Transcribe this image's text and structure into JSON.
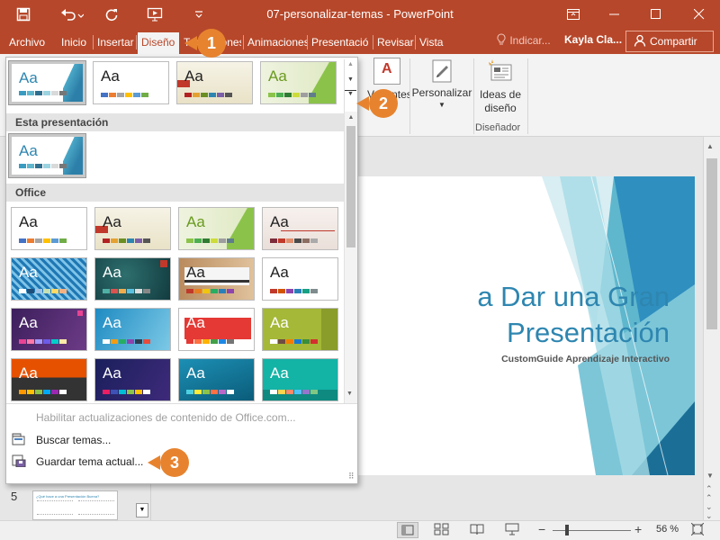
{
  "titlebar": {
    "document_title": "07-personalizar-temas  -  PowerPoint",
    "qat": {
      "save_icon": "save-icon",
      "undo_icon": "undo-icon",
      "redo_icon": "redo-icon",
      "present_icon": "present-from-start-icon",
      "more_icon": "customize-qat-icon"
    },
    "window_buttons": [
      "ribbon-display-options-icon",
      "minimize-icon",
      "maximize-icon",
      "close-icon"
    ]
  },
  "tabs": [
    "Archivo",
    "Inicio",
    "Insertar",
    "Diseño",
    "Transiciones",
    "Animaciones",
    "Presentació",
    "Revisar",
    "Vista"
  ],
  "tell_me": "Indicar...",
  "user_name": "Kayla Cla...",
  "share_label": "Compartir",
  "ribbon": {
    "variants_label": "Variantes",
    "customize_label": "Personalizar",
    "design_ideas_label": "Ideas de diseño",
    "designer_group": "Diseñador"
  },
  "gallery": {
    "section_this": "Esta presentación",
    "section_office": "Office",
    "aa": "Aa",
    "menu": {
      "enable_updates": "Habilitar actualizaciones de contenido de Office.com...",
      "browse": "Buscar temas...",
      "save": "Guardar tema actual..."
    }
  },
  "slide": {
    "title_line1": "a Dar una Gran",
    "title_line2": "Presentación",
    "subtitle": "CustomGuide Aprendizaje Interactivo"
  },
  "thumbnail": {
    "number": "5",
    "text": "¿Qué hace a una Presentación Buena?"
  },
  "status": {
    "zoom": "56 %"
  },
  "callouts": [
    "1",
    "2",
    "3"
  ],
  "colors": {
    "accent": "#b7472a",
    "callout": "#e7832f",
    "slide_blue": "#2e86b0"
  }
}
